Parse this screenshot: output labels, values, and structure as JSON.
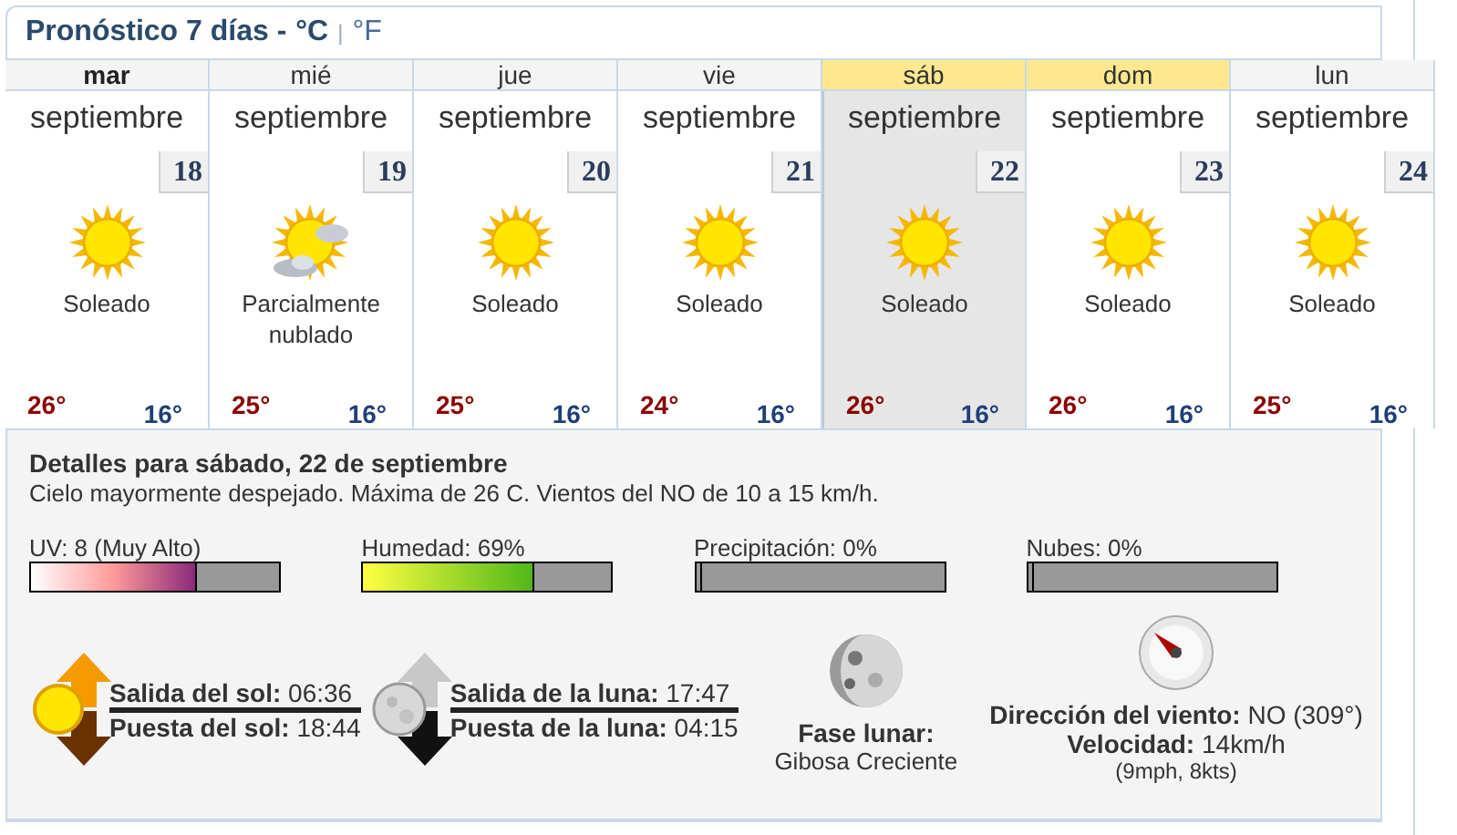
{
  "title": {
    "text": "Pronóstico 7 días -",
    "units": [
      {
        "label": "°C",
        "selected": true
      },
      {
        "label": "°F",
        "selected": false
      }
    ],
    "separator": "|"
  },
  "days": [
    {
      "weekday": "mar",
      "month": "septiembre",
      "date": "18",
      "kind": "sunny",
      "condition": "Soleado",
      "high": "26°",
      "low": "16°",
      "today": true,
      "weekend": false,
      "selected": false
    },
    {
      "weekday": "mié",
      "month": "septiembre",
      "date": "19",
      "kind": "partly-cloudy",
      "condition": "Parcialmente nublado",
      "high": "25°",
      "low": "16°",
      "today": false,
      "weekend": false,
      "selected": false
    },
    {
      "weekday": "jue",
      "month": "septiembre",
      "date": "20",
      "kind": "sunny",
      "condition": "Soleado",
      "high": "25°",
      "low": "16°",
      "today": false,
      "weekend": false,
      "selected": false
    },
    {
      "weekday": "vie",
      "month": "septiembre",
      "date": "21",
      "kind": "sunny",
      "condition": "Soleado",
      "high": "24°",
      "low": "16°",
      "today": false,
      "weekend": false,
      "selected": false
    },
    {
      "weekday": "sáb",
      "month": "septiembre",
      "date": "22",
      "kind": "sunny",
      "condition": "Soleado",
      "high": "26°",
      "low": "16°",
      "today": false,
      "weekend": true,
      "selected": true
    },
    {
      "weekday": "dom",
      "month": "septiembre",
      "date": "23",
      "kind": "sunny",
      "condition": "Soleado",
      "high": "26°",
      "low": "16°",
      "today": false,
      "weekend": true,
      "selected": false
    },
    {
      "weekday": "lun",
      "month": "septiembre",
      "date": "24",
      "kind": "sunny",
      "condition": "Soleado",
      "high": "25°",
      "low": "16°",
      "today": false,
      "weekend": false,
      "selected": false
    }
  ],
  "details": {
    "heading": "Detalles para sábado, 22 de septiembre",
    "summary": "Cielo mayormente despejado. Máxima de 26 C. Vientos del NO de 10 a 15 km/h.",
    "meters": [
      {
        "label": "UV: 8 (Muy Alto)",
        "kind": "uv",
        "level": 0.67
      },
      {
        "label": "Humedad: 69%",
        "kind": "humidity",
        "level": 0.69
      },
      {
        "label": "Precipitación: 0%",
        "kind": "plain",
        "level": 0
      },
      {
        "label": "Nubes: 0%",
        "kind": "plain",
        "level": 0
      }
    ],
    "sun": {
      "rise": "**Salida del sol:** 06:36",
      "set": "**Puesta del sol:** 18:44"
    },
    "moon": {
      "rise": "**Salida de la luna:** 17:47",
      "set": "**Puesta de la luna:** 04:15"
    },
    "moon_phase": {
      "label": "Fase lunar:",
      "value": "Gibosa Creciente"
    },
    "wind": {
      "direction": "**Dirección del viento:** NO (309°)",
      "speed": "**Velocidad:** 14km/h",
      "speed_alt": "(9mph, 8kts)"
    }
  }
}
